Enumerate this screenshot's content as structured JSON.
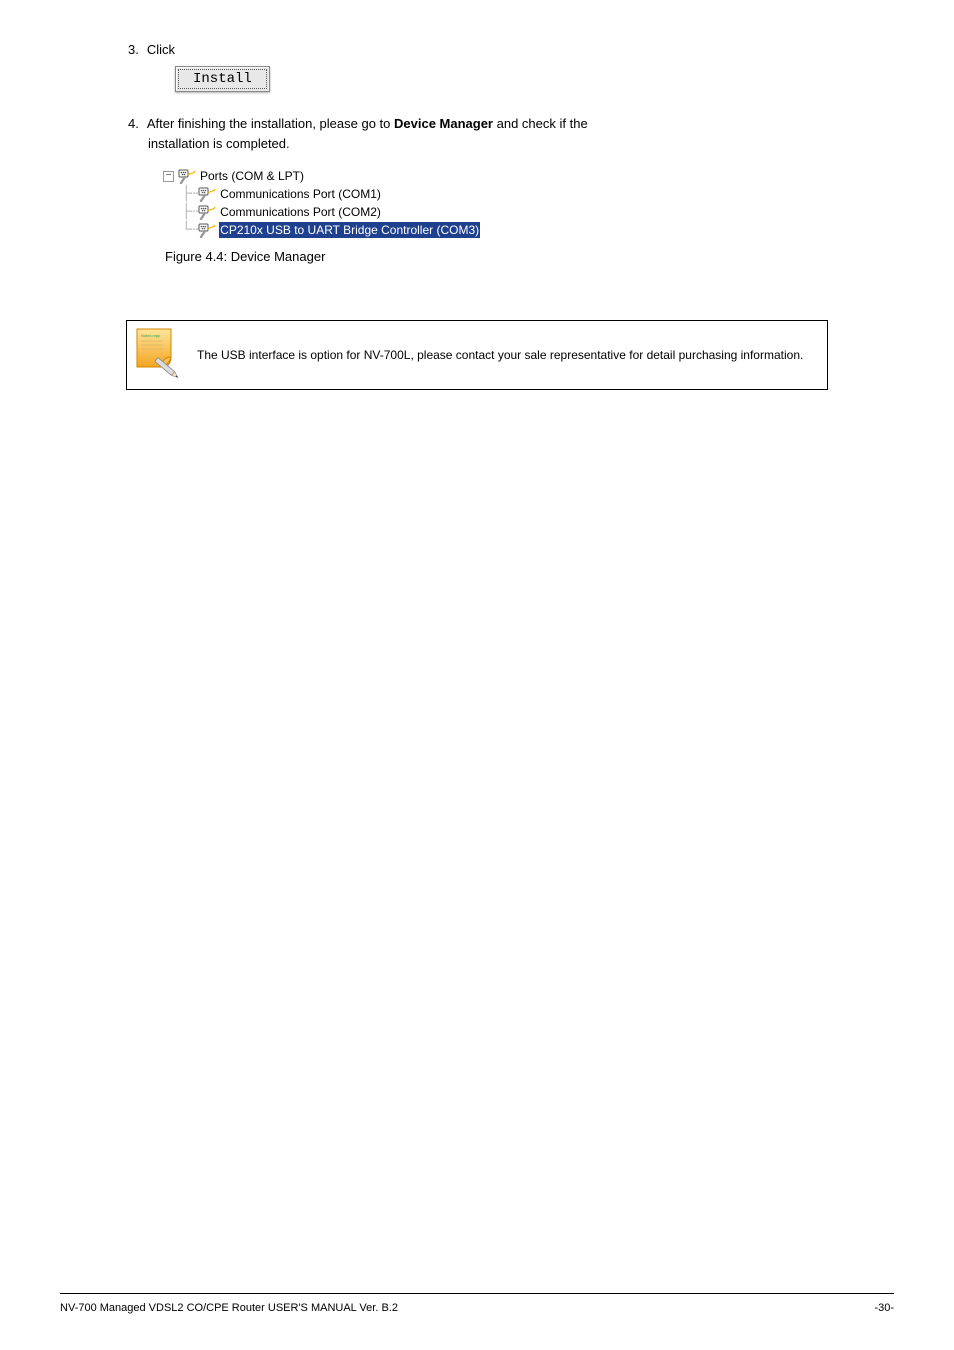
{
  "step3": {
    "num": "3.",
    "text": "Click"
  },
  "install_btn": {
    "label": "Install"
  },
  "step4": {
    "num": "4.",
    "line1a": "After finishing the installation, please go to ",
    "line1b": "Device Manager",
    "line1c": " and check if the",
    "line2": "installation is completed."
  },
  "tree": {
    "root": "Ports (COM & LPT)",
    "items": [
      "Communications Port (COM1)",
      "Communications Port (COM2)",
      "CP210x USB to UART Bridge Controller (COM3)"
    ]
  },
  "fig_caption": "Figure 4.4: Device Manager",
  "note_icon_label": "Notes.mpp",
  "note_text": "The USB interface is option for NV-700L, please contact your sale representative for detail purchasing information.",
  "footer": {
    "left": "NV-700 Managed VDSL2 CO/CPE Router USER'S MANUAL  Ver. B.2",
    "right": "-30-"
  }
}
